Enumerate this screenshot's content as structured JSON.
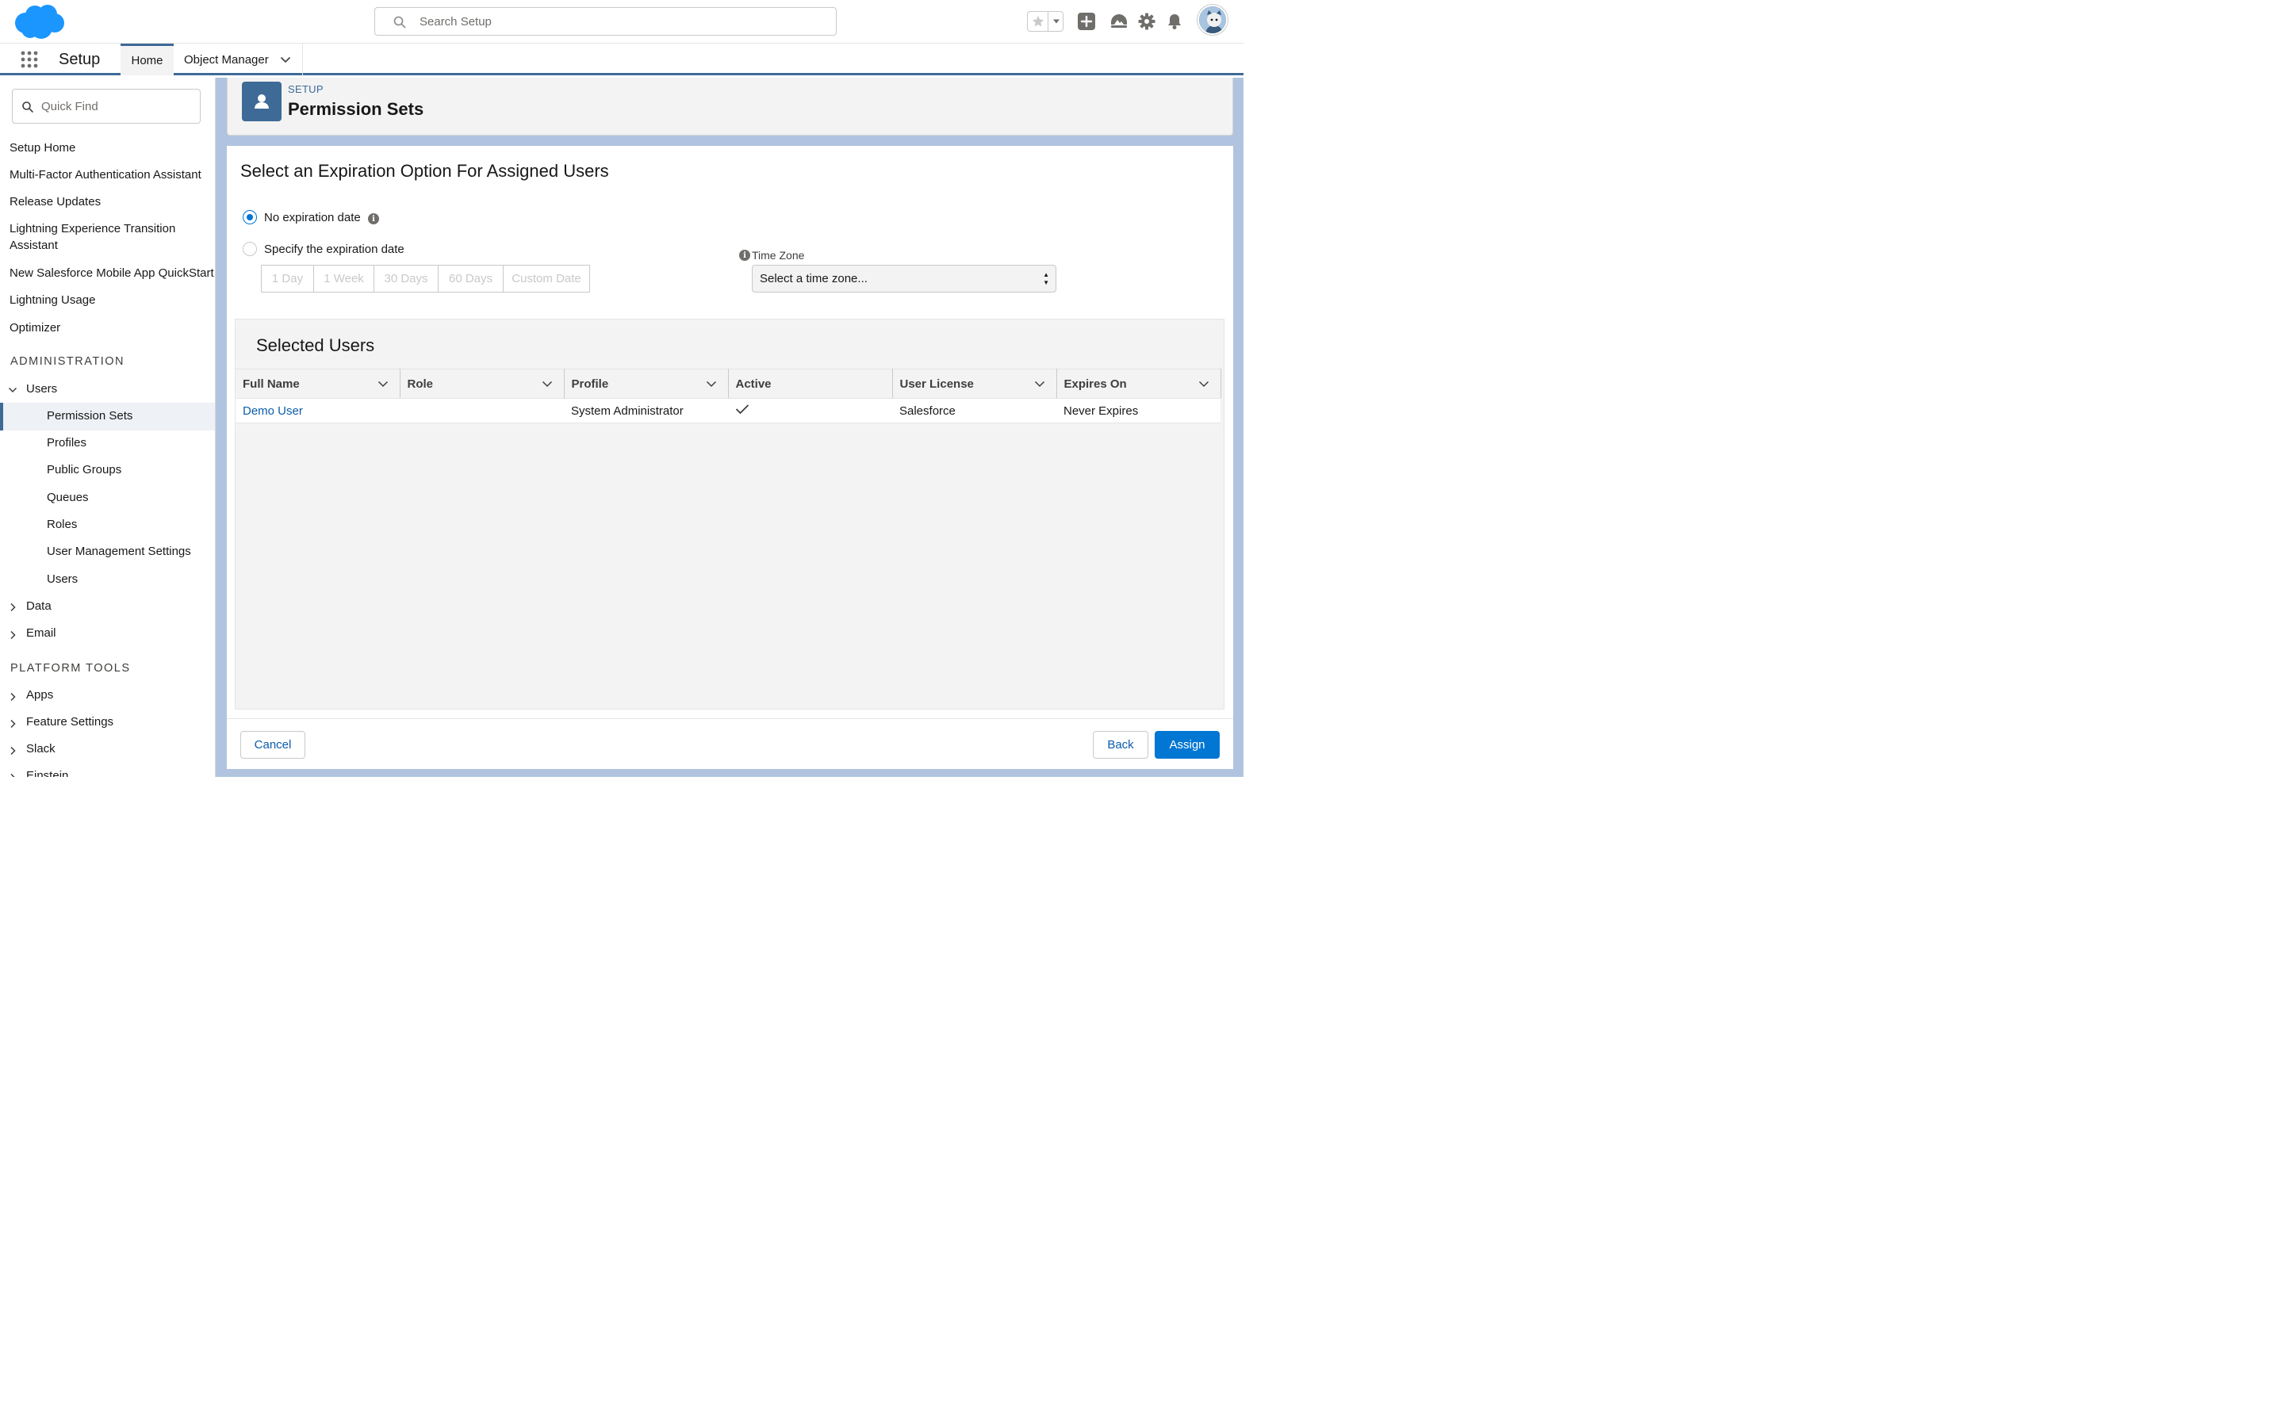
{
  "header": {
    "search_placeholder": "Search Setup",
    "icons": [
      "favorites-star-icon",
      "favorites-dropdown-icon",
      "global-actions-icon",
      "trailhead-icon",
      "setup-gear-icon",
      "notifications-bell-icon",
      "user-avatar"
    ]
  },
  "nav": {
    "app_name": "Setup",
    "tabs": [
      {
        "label": "Home",
        "active": true
      },
      {
        "label": "Object Manager"
      }
    ]
  },
  "sidebar": {
    "quick_find_placeholder": "Quick Find",
    "top_items": [
      "Setup Home",
      "Multi-Factor Authentication Assistant",
      "Release Updates",
      "Lightning Experience Transition Assistant",
      "New Salesforce Mobile App QuickStart",
      "Lightning Usage",
      "Optimizer"
    ],
    "section_admin": "ADMINISTRATION",
    "users_label": "Users",
    "users_children": [
      "Permission Sets",
      "Profiles",
      "Public Groups",
      "Queues",
      "Roles",
      "User Management Settings",
      "Users"
    ],
    "data_label": "Data",
    "email_label": "Email",
    "section_platform": "PLATFORM TOOLS",
    "platform_items": [
      "Apps",
      "Feature Settings",
      "Slack",
      "Einstein"
    ]
  },
  "page_header": {
    "supertitle": "SETUP",
    "title": "Permission Sets"
  },
  "form": {
    "heading": "Select an Expiration Option For Assigned Users",
    "option_none": "No expiration date",
    "option_specify": "Specify the expiration date",
    "selected_option": "No expiration date",
    "durations": [
      "1 Day",
      "1 Week",
      "30 Days",
      "60 Days",
      "Custom Date"
    ],
    "timezone_label": "Time Zone",
    "timezone_value": "Select a time zone..."
  },
  "selected_users": {
    "title": "Selected Users",
    "columns": [
      "Full Name",
      "Role",
      "Profile",
      "Active",
      "User License",
      "Expires On"
    ],
    "rows": [
      {
        "full_name": "Demo User",
        "role": "",
        "profile": "System Administrator",
        "active": true,
        "user_license": "Salesforce",
        "expires_on": "Never Expires"
      }
    ]
  },
  "footer": {
    "cancel": "Cancel",
    "back": "Back",
    "assign": "Assign"
  },
  "colors": {
    "brand": "#0176d3",
    "link": "#0b5cab",
    "nav_accent": "#3e6a97",
    "logo": "#1b96ff"
  }
}
